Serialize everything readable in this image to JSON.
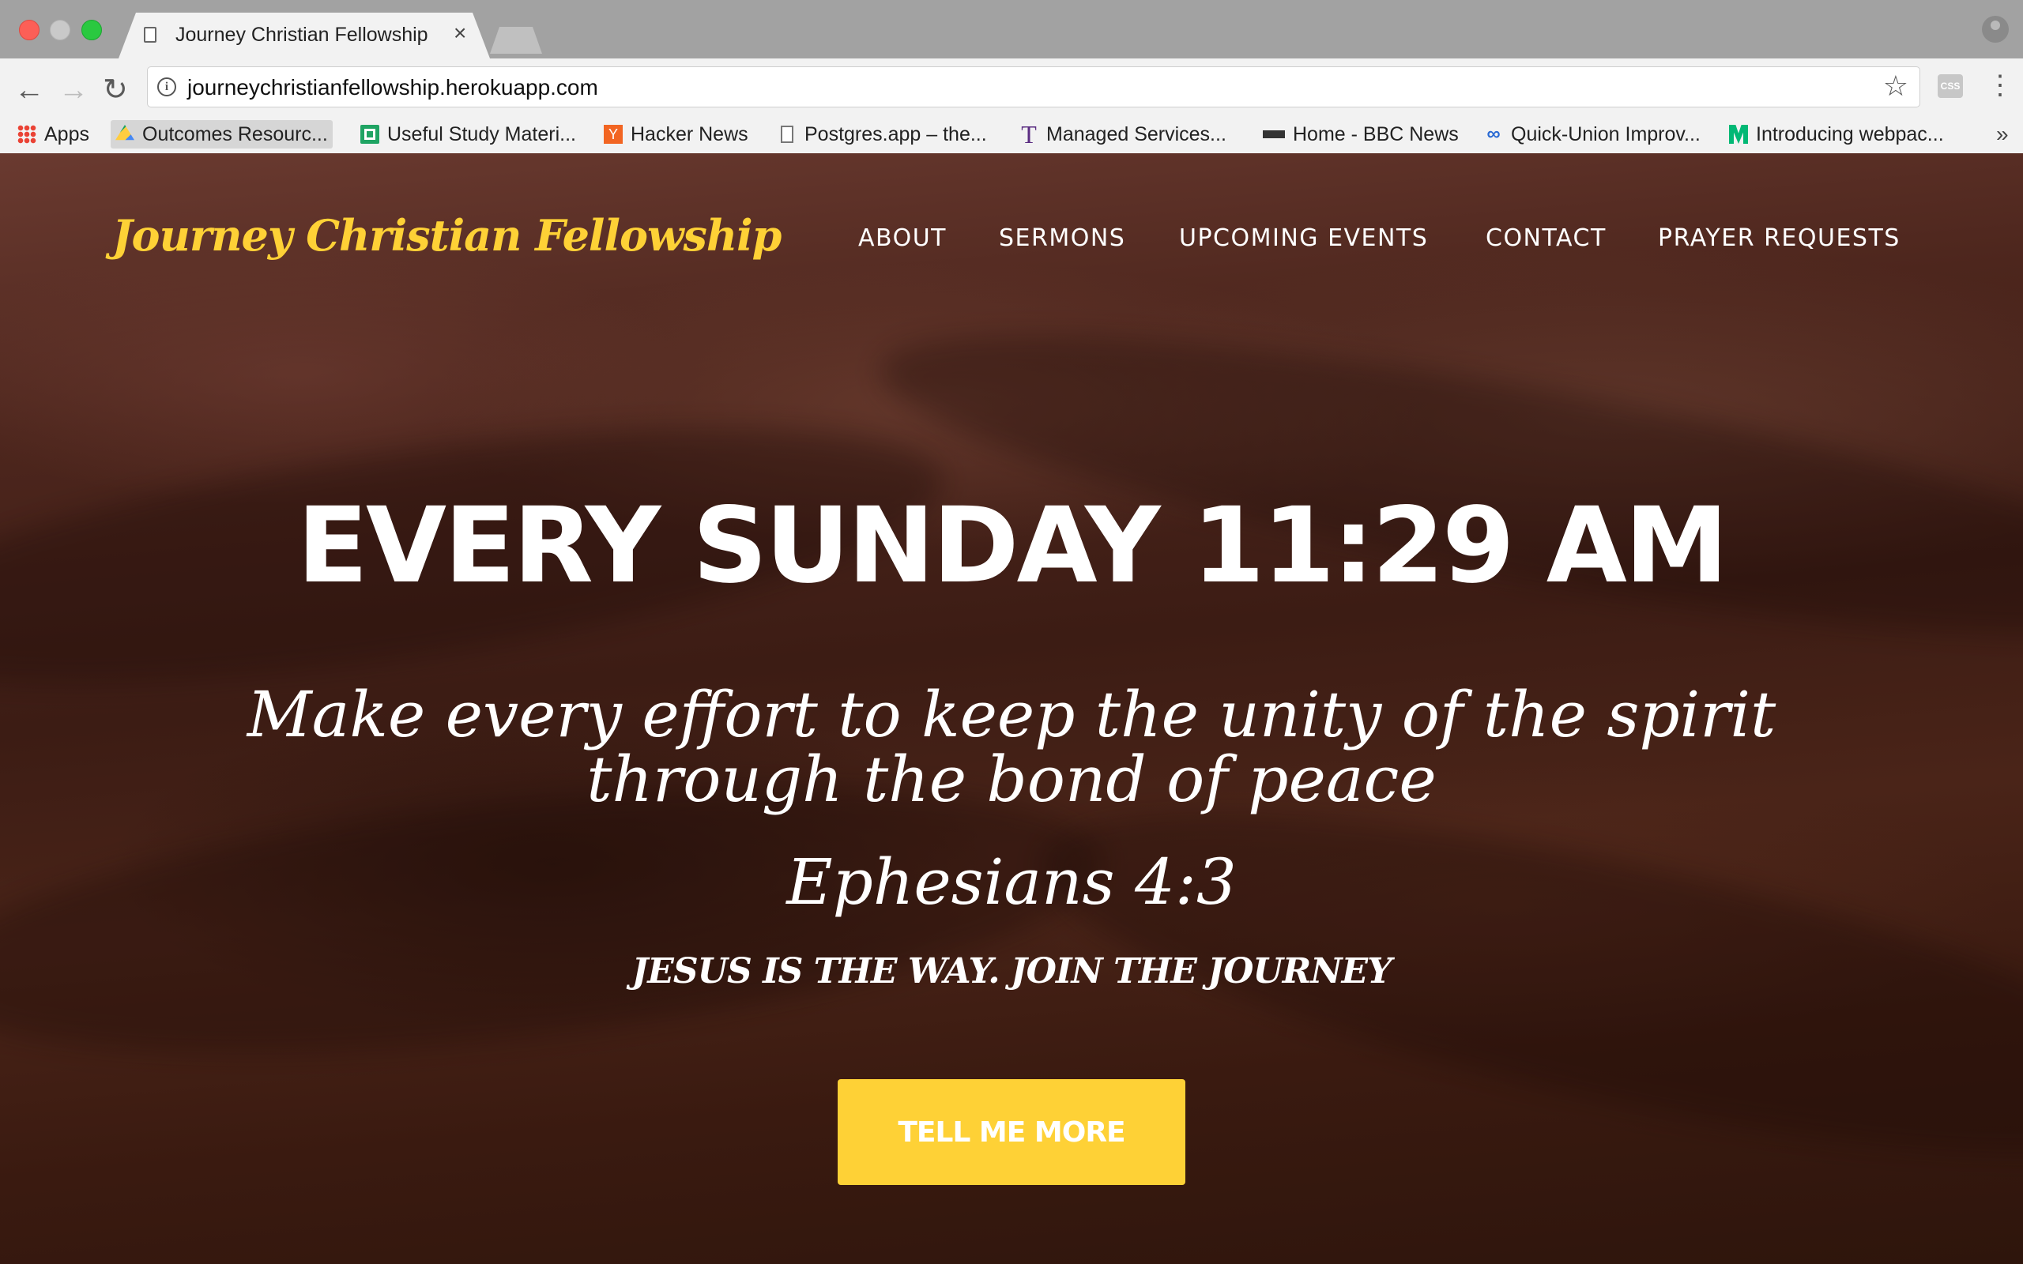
{
  "browser": {
    "tab": {
      "title": "Journey Christian Fellowship",
      "close_glyph": "×",
      "icon": "document-icon"
    },
    "url": "journeychristianfellowship.herokuapp.com",
    "bookmarks": [
      {
        "label": "Apps",
        "icon": "apps-grid-icon"
      },
      {
        "label": "Outcomes Resourc...",
        "icon": "google-drive-icon"
      },
      {
        "label": "Useful Study Materi...",
        "icon": "google-sheets-icon"
      },
      {
        "label": "Hacker News",
        "icon": "ycombinator-icon"
      },
      {
        "label": "Postgres.app – the...",
        "icon": "document-icon"
      },
      {
        "label": "Managed Services...",
        "icon": "t-logo-icon"
      },
      {
        "label": "Home - BBC News",
        "icon": "bbc-icon"
      },
      {
        "label": "Quick-Union Improv...",
        "icon": "chain-link-icon"
      },
      {
        "label": "Introducing webpac...",
        "icon": "medium-icon"
      }
    ],
    "bookmarks_overflow": "»",
    "extension_label": "CSS"
  },
  "site": {
    "logo": "Journey Christian Fellowship",
    "nav": [
      "ABOUT",
      "SERMONS",
      "UPCOMING EVENTS",
      "CONTACT",
      "PRAYER REQUESTS"
    ],
    "headline": "EVERY SUNDAY 11:29 AM",
    "verse": "Make every effort to keep the unity of the spirit through the bond of peace",
    "reference": "Ephesians 4:3",
    "tagline": "JESUS IS THE WAY. JOIN THE JOURNEY",
    "cta_label": "TELL ME MORE"
  },
  "colors": {
    "accent": "#fed136",
    "tabstrip": "#a2a2a2",
    "toolbar": "#f2f2f2"
  }
}
